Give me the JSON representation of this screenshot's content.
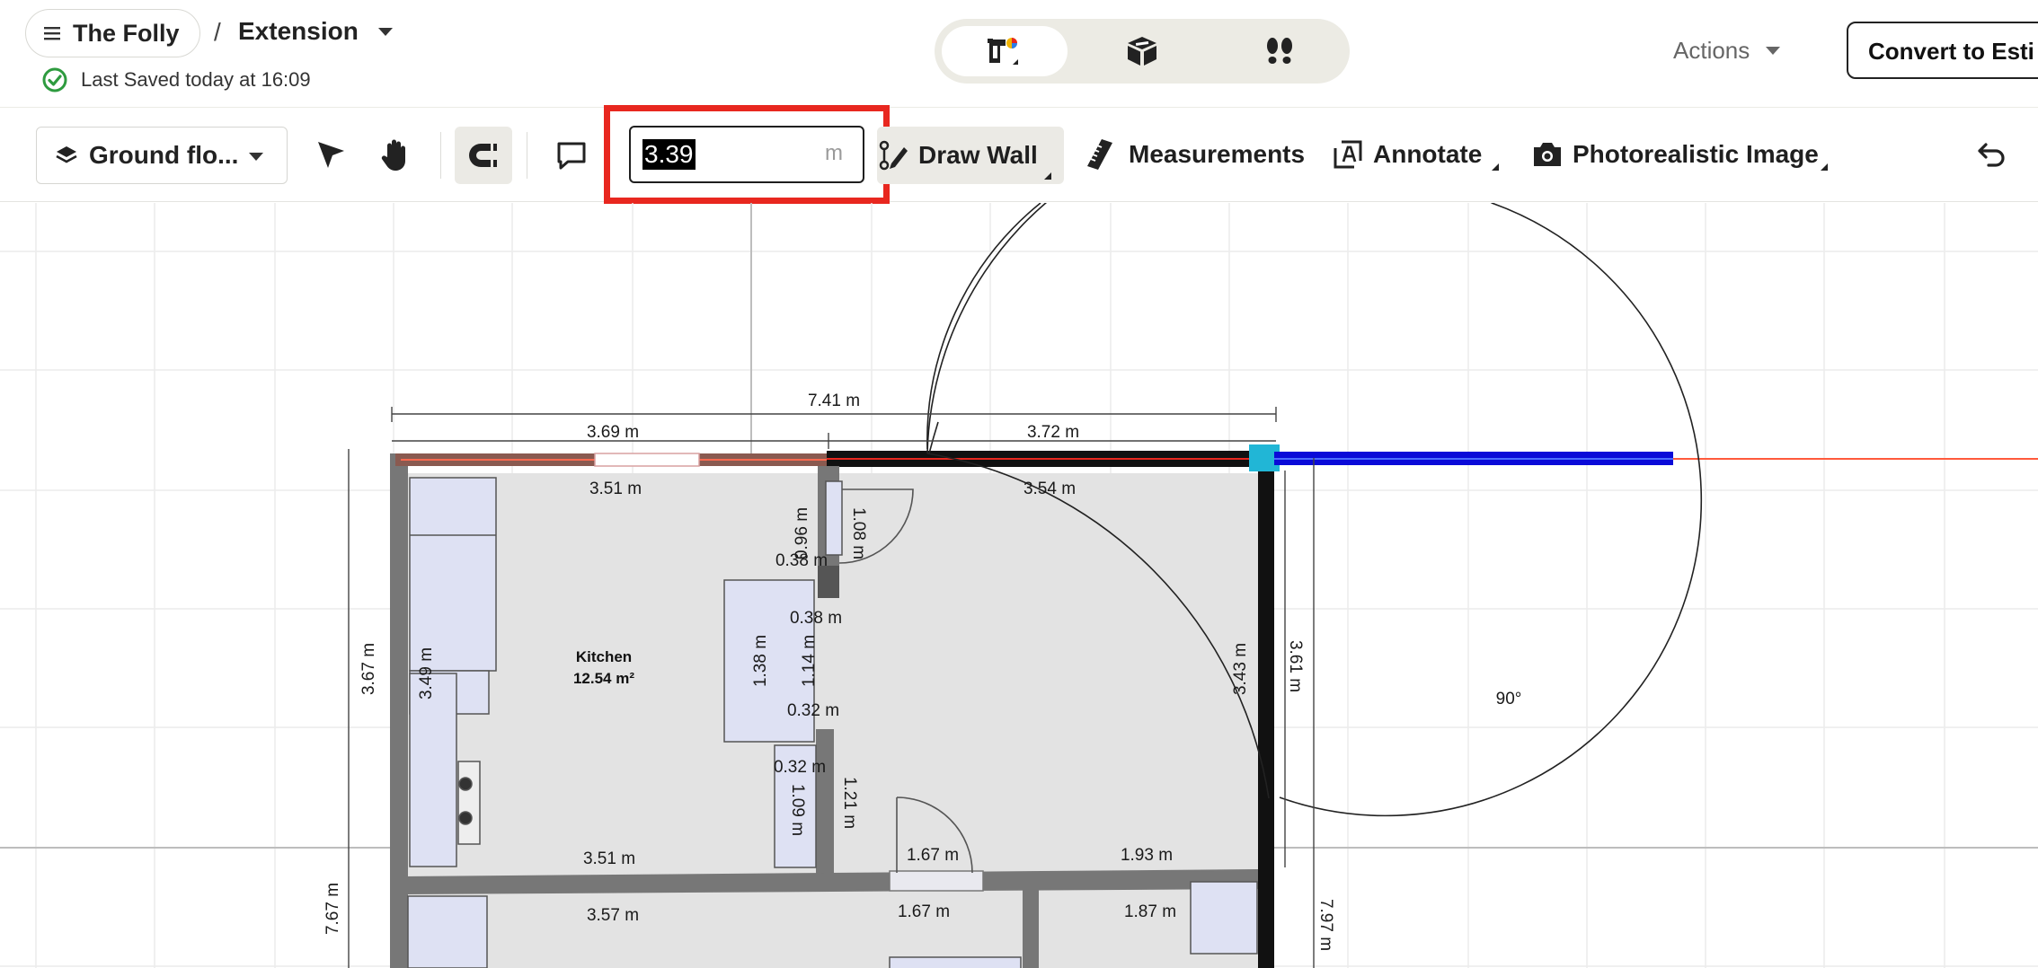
{
  "header": {
    "project_name": "The Folly",
    "separator": "/",
    "section_name": "Extension",
    "saved_status": "Last Saved today at 16:09",
    "actions_label": "Actions",
    "convert_label": "Convert to Esti",
    "view_modes": [
      "floor-plan-icon",
      "3d-box-icon",
      "walkthrough-icon"
    ]
  },
  "toolbar": {
    "floor_label": "Ground flo...",
    "length_value": "3.39",
    "length_unit": "m",
    "draw_wall_label": "Draw Wall",
    "measurements_label": "Measurements",
    "annotate_label": "Annotate",
    "photo_label": "Photorealistic Image"
  },
  "plan": {
    "room_name": "Kitchen",
    "room_area": "12.54 m²",
    "angle_label": "90°",
    "dims": {
      "total_top": "7.41 m",
      "top_left": "3.69 m",
      "top_right": "3.72 m",
      "inner_left": "3.51 m",
      "inner_right": "3.54 m",
      "d096": "0.96 m",
      "d108": "1.08 m",
      "d038a": "0.38 m",
      "d038b": "0.38 m",
      "d138": "1.38 m",
      "d114": "1.14 m",
      "d032a": "0.32 m",
      "d032b": "0.32 m",
      "d109": "1.09 m",
      "d121": "1.21 m",
      "d367": "3.67 m",
      "d349": "3.49 m",
      "d343": "3.43 m",
      "d361": "3.61 m",
      "bottom_left": "3.51 m",
      "d167a": "1.67 m",
      "d193": "1.93 m",
      "d357": "3.57 m",
      "d167b": "1.67 m",
      "d187": "1.87 m",
      "d767": "7.67 m",
      "d797": "7.97 m"
    }
  },
  "colors": {
    "accent_red": "#e8271f",
    "wall_draw_blue": "#0a0ad8",
    "snap_cyan": "#21b6d6",
    "saved_green": "#2e9b3f"
  }
}
